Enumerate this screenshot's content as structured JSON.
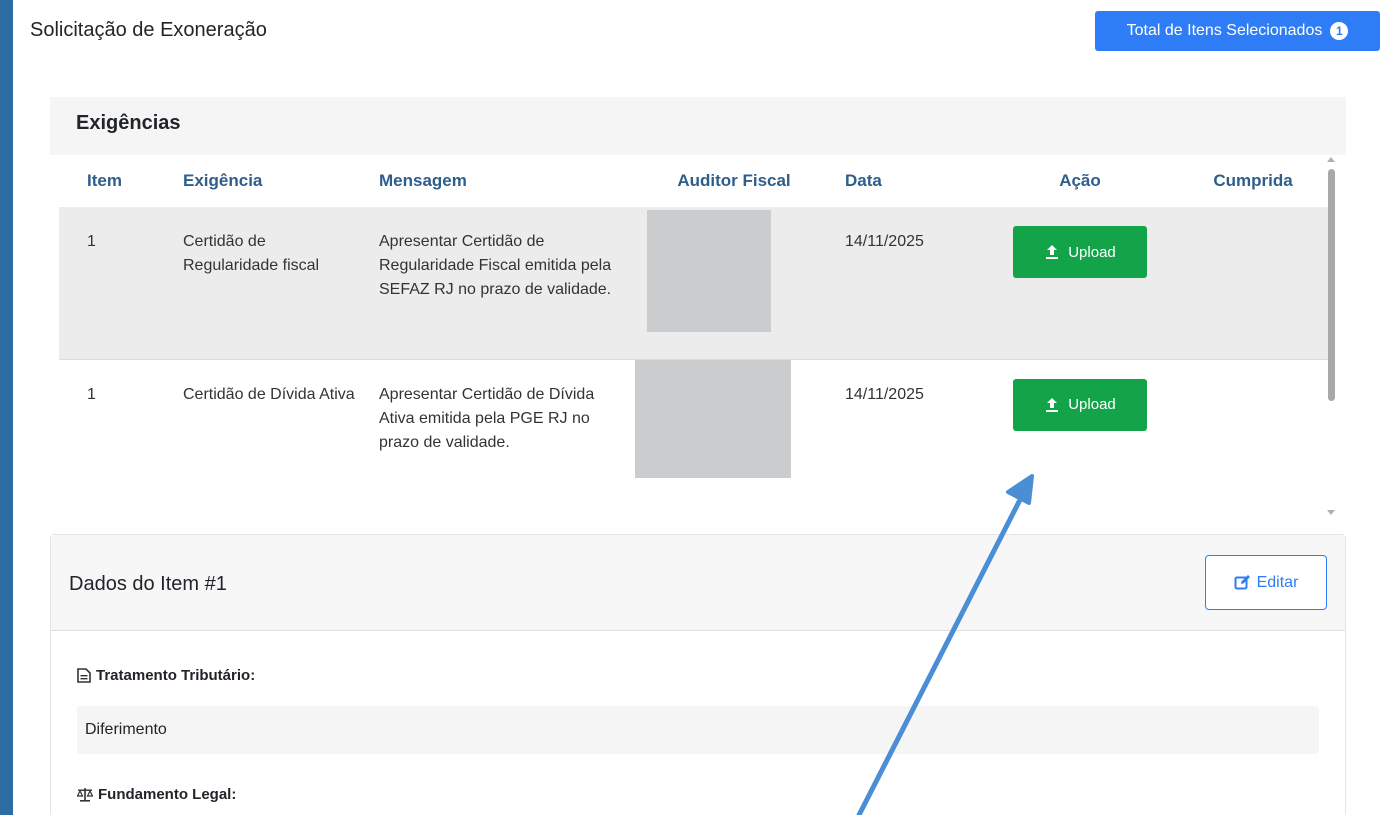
{
  "page": {
    "title": "Solicitação de Exoneração",
    "total_button": {
      "label": "Total de Itens Selecionados",
      "count": "1"
    }
  },
  "exigencias": {
    "title": "Exigências",
    "columns": [
      "Item",
      "Exigência",
      "Mensagem",
      "Auditor Fiscal",
      "Data",
      "Ação",
      "Cumprida"
    ],
    "rows": [
      {
        "item": "1",
        "exigencia": "Certidão de Regularidade fiscal",
        "mensagem": "Apresentar Certidão de Regularidade Fiscal emitida pela SEFAZ RJ no prazo de validade.",
        "auditor": "",
        "data": "14/11/2025",
        "acao": "Upload",
        "cumprida": ""
      },
      {
        "item": "1",
        "exigencia": "Certidão de Dívida Ativa",
        "mensagem": "Apresentar Certidão de Dívida Ativa emitida pela PGE RJ no prazo de validade.",
        "auditor": "",
        "data": "14/11/2025",
        "acao": "Upload",
        "cumprida": ""
      }
    ]
  },
  "dados_item": {
    "title": "Dados do Item #1",
    "edit_label": "Editar",
    "tratamento_label": "Tratamento Tributário:",
    "tratamento_value": "Diferimento",
    "fundamento_label": "Fundamento Legal:"
  },
  "icons": {
    "upload": "upload-icon",
    "edit": "edit-icon",
    "document": "document-icon",
    "scale": "balance-scale-icon"
  },
  "colors": {
    "primary": "#2f7df6",
    "success": "#13a44a",
    "header_text": "#2e5e8c",
    "left_bar": "#2e6da4",
    "annotation_arrow": "#4a8fd6"
  }
}
